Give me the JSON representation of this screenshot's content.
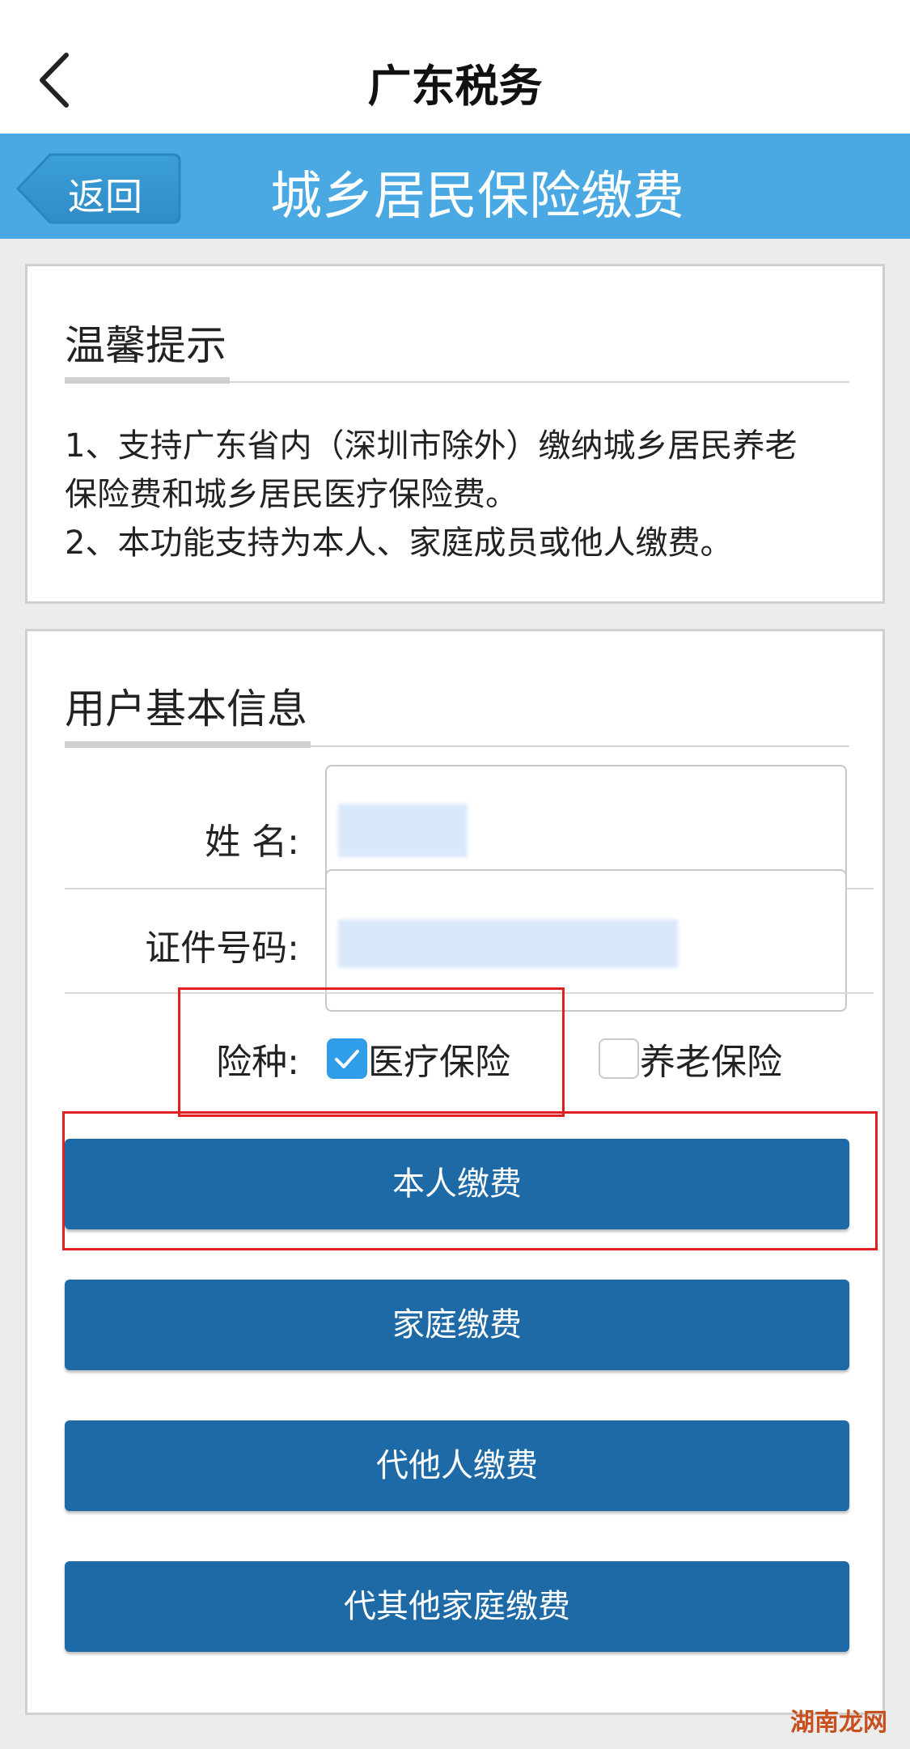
{
  "header": {
    "app_title": "广东税务"
  },
  "subheader": {
    "back_label": "返回",
    "page_title": "城乡居民保险缴费"
  },
  "tips": {
    "heading": "温馨提示",
    "lines": [
      "1、支持广东省内（深圳市除外）缴纳城乡居民养老",
      "保险费和城乡居民医疗保险费。",
      "2、本功能支持为本人、家庭成员或他人缴费。"
    ]
  },
  "user_info": {
    "heading": "用户基本信息",
    "name_label": "姓 名:",
    "id_label": "证件号码:",
    "insurance_label": "险种:",
    "options": [
      {
        "label": "医疗保险",
        "checked": true
      },
      {
        "label": "养老保险",
        "checked": false
      }
    ]
  },
  "buttons": {
    "self_pay": "本人缴费",
    "family_pay": "家庭缴费",
    "others_pay": "代他人缴费",
    "other_family_pay": "代其他家庭缴费"
  },
  "watermark": "湖南龙网",
  "colors": {
    "subheader_bg": "#4aa9e3",
    "button_bg": "#1e6aa6",
    "checkbox_on": "#2f9de8",
    "highlight_red": "#e02020"
  }
}
